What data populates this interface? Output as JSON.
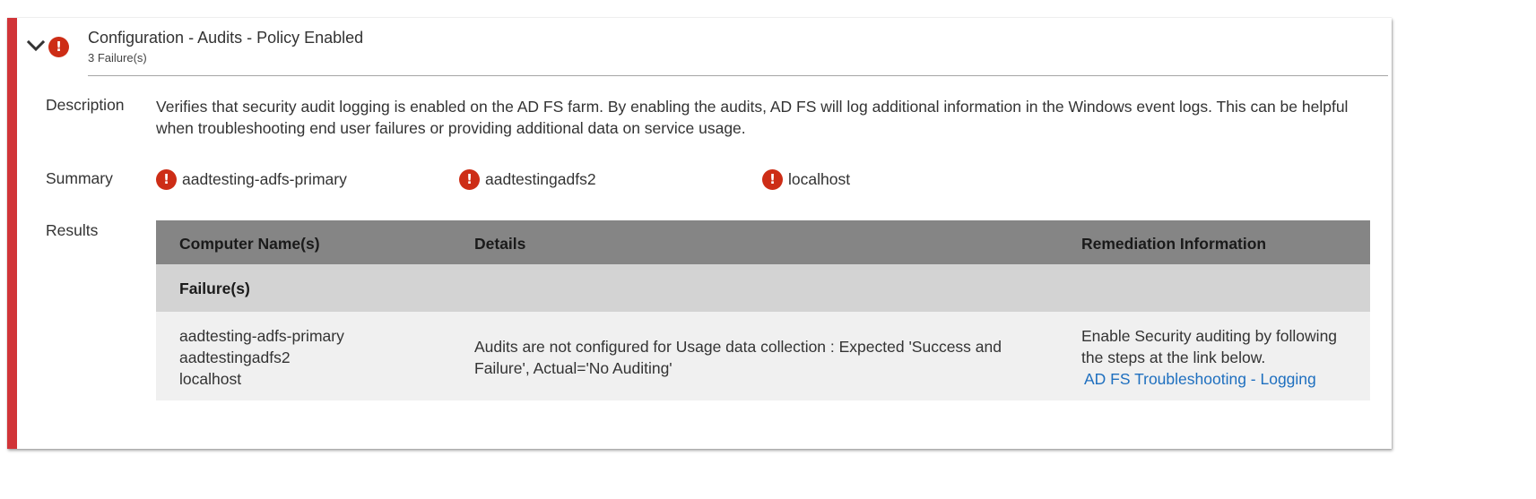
{
  "rule": {
    "title": "Configuration - Audits - Policy Enabled",
    "subtitle": "3 Failure(s)",
    "status_icon": "error-icon",
    "expand_icon": "chevron-down-icon",
    "accent_color": "#d13438",
    "error_color": "#cd2d16"
  },
  "description": {
    "label": "Description",
    "text": "Verifies that security audit logging is enabled on the AD FS farm. By enabling the audits, AD FS will log additional information in the Windows event logs. This can be helpful when troubleshooting end user failures or providing additional data on service usage."
  },
  "summary": {
    "label": "Summary",
    "items": [
      {
        "name": "aadtesting-adfs-primary",
        "status": "error"
      },
      {
        "name": "aadtestingadfs2",
        "status": "error"
      },
      {
        "name": "localhost",
        "status": "error"
      }
    ]
  },
  "results": {
    "label": "Results",
    "columns": [
      "Computer Name(s)",
      "Details",
      "Remediation Information"
    ],
    "group_label": "Failure(s)",
    "rows": [
      {
        "computers": [
          "aadtesting-adfs-primary",
          "aadtestingadfs2",
          "localhost"
        ],
        "details": "Audits are not configured for Usage data collection : Expected 'Success and Failure', Actual='No Auditing'",
        "remediation_lines": [
          "Enable Security auditing by following",
          "the steps at the link below."
        ],
        "remediation_link": "AD FS Troubleshooting - Logging"
      }
    ]
  }
}
